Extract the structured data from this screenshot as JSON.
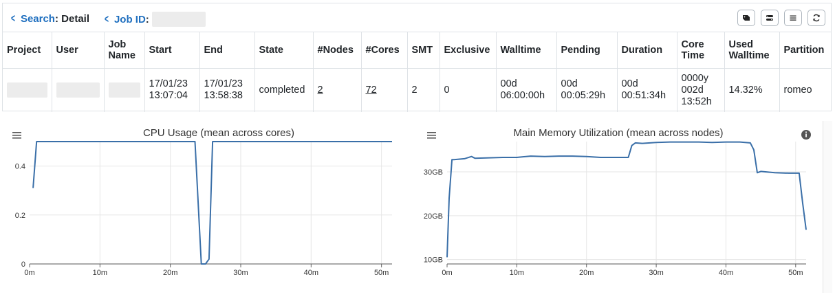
{
  "breadcrumb": {
    "search_link": "Search",
    "search_rest": ": Detail",
    "jobid_link": "Job ID",
    "jobid_rest": ":"
  },
  "toolbar": {
    "buttons": [
      "tag-icon",
      "stats-icon",
      "list-icon",
      "refresh-icon"
    ]
  },
  "table": {
    "headers": [
      "Project",
      "User",
      "Job Name",
      "Start",
      "End",
      "State",
      "#Nodes",
      "#Cores",
      "SMT",
      "Exclusive",
      "Walltime",
      "Pending",
      "Duration",
      "Core Time",
      "Used Walltime",
      "Partition"
    ],
    "row": {
      "start": "17/01/23 13:07:04",
      "end": "17/01/23 13:58:38",
      "state": "completed",
      "nodes": "2",
      "cores": "72",
      "smt": "2",
      "exclusive": "0",
      "walltime": "00d 06:00:00h",
      "pending": "00d 00:05:29h",
      "duration": "00d 00:51:34h",
      "core_time": "0000y 002d 13:52h",
      "used_walltime": "14.32%",
      "partition": "romeo"
    }
  },
  "colors": {
    "accent": "#1f6fbf",
    "series": "#3a6fa8",
    "grid": "#e6e6e6"
  },
  "chart_data": [
    {
      "type": "line",
      "title": "CPU Usage (mean across cores)",
      "x_ticks": [
        "0m",
        "10m",
        "20m",
        "30m",
        "40m",
        "50m"
      ],
      "y_ticks": [
        "0",
        "0.2",
        "0.4"
      ],
      "xlim": [
        0,
        51.5
      ],
      "ylim": [
        0,
        0.5
      ],
      "x": [
        0.5,
        1.0,
        23.5,
        24.4,
        25.0,
        25.5,
        26.0,
        30.0,
        40.0,
        51.5
      ],
      "y": [
        0.31,
        0.5,
        0.5,
        0.0,
        0.0,
        0.02,
        0.5,
        0.5,
        0.5,
        0.5
      ]
    },
    {
      "type": "line",
      "title": "Main Memory Utilization (mean across nodes)",
      "x_ticks": [
        "0m",
        "10m",
        "20m",
        "30m",
        "40m",
        "50m"
      ],
      "y_ticks": [
        "10GB",
        "20GB",
        "30GB"
      ],
      "xlim": [
        0,
        51.5
      ],
      "ylim": [
        9,
        36.9
      ],
      "x": [
        0,
        0.3,
        0.7,
        1.0,
        2.5,
        3.5,
        4.0,
        6,
        8,
        10,
        12,
        14,
        16,
        18,
        20,
        22,
        24,
        26,
        26.5,
        27,
        28,
        30,
        32,
        34,
        36,
        38,
        40,
        42,
        43.5,
        44,
        44.5,
        45,
        47,
        49,
        50.5,
        51,
        51.5
      ],
      "y": [
        10.5,
        24,
        32.8,
        32.8,
        33.0,
        33.5,
        33.1,
        33.2,
        33.3,
        33.3,
        33.6,
        33.5,
        33.6,
        33.6,
        33.5,
        33.3,
        33.3,
        33.3,
        36.0,
        36.6,
        36.5,
        36.7,
        36.8,
        36.8,
        36.8,
        36.7,
        36.8,
        36.8,
        36.6,
        35.0,
        29.8,
        30.1,
        29.8,
        29.7,
        29.7,
        23.0,
        16.8
      ]
    }
  ]
}
